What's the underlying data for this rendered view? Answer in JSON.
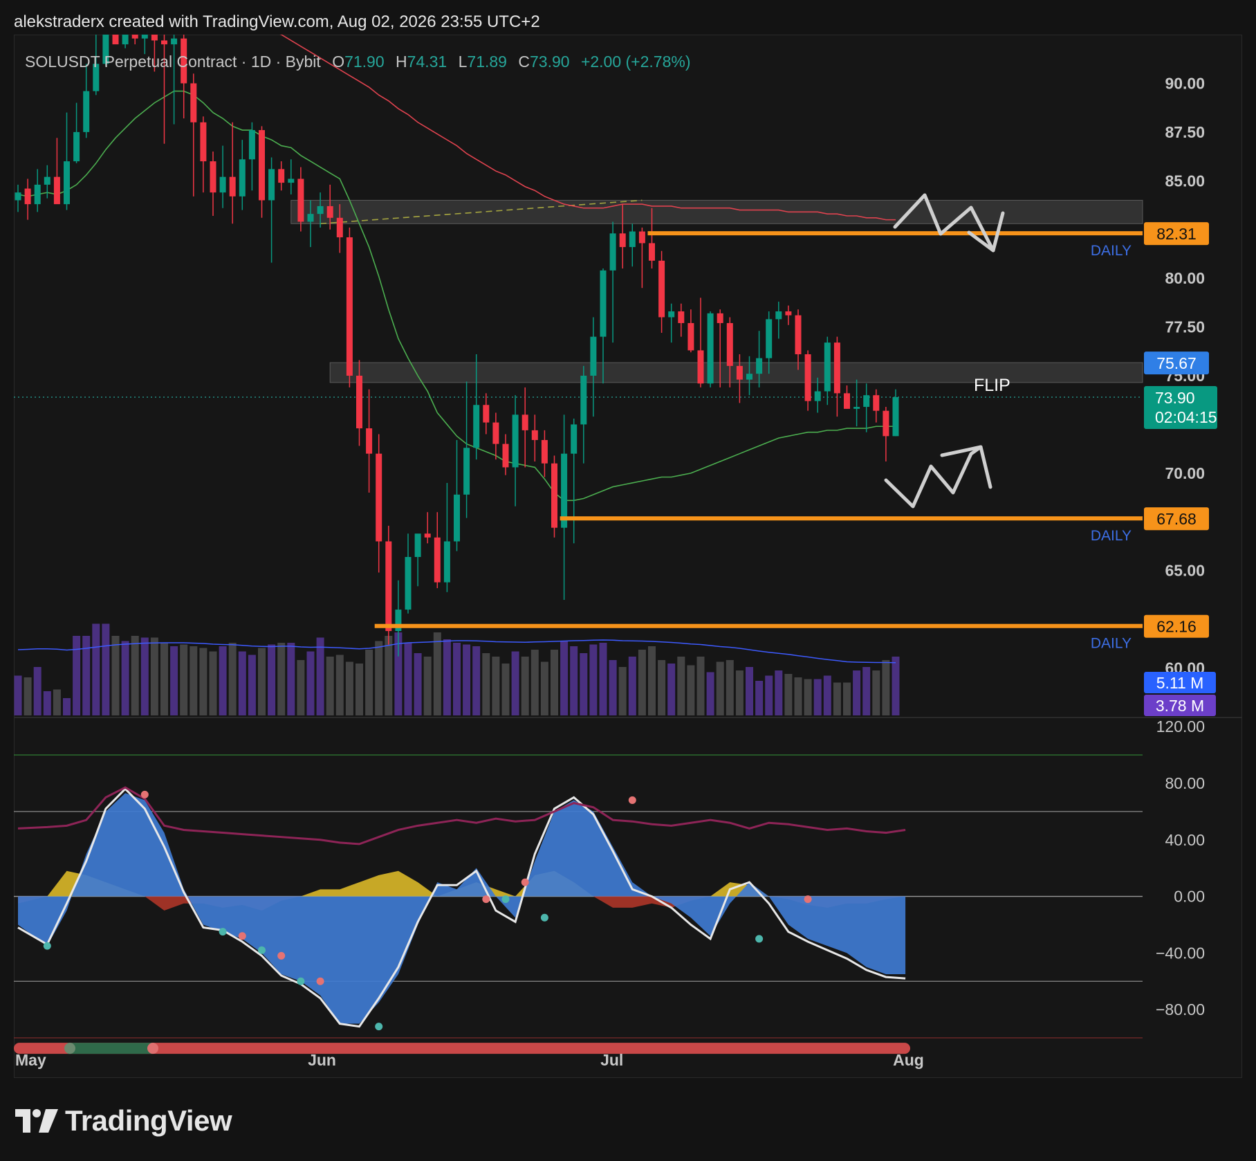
{
  "header": {
    "attribution": "alekstraderx created with TradingView.com, Aug 02, 2026 23:55 UTC+2"
  },
  "legend": {
    "title": "SOLUSDT Perpetual Contract · 1D · Bybit",
    "o_label": "O",
    "o": "71.90",
    "h_label": "H",
    "h": "74.31",
    "l_label": "L",
    "l": "71.89",
    "c_label": "C",
    "c": "73.90",
    "change": "+2.00 (+2.78%)"
  },
  "brand": {
    "name": "TradingView"
  },
  "colors": {
    "up": "#089981",
    "down": "#f23645",
    "level": "#f7931a",
    "ema_slow": "#e0434f",
    "ema_fast": "#4caf50",
    "volume_avg": "#3d5afe",
    "wave": "#3f7bd1",
    "money_flow": "#e6c229"
  },
  "chart_data": [
    {
      "type": "candlestick",
      "price_axis": {
        "ylim": [
          57.5,
          92.5
        ],
        "tick_values": [
          60,
          65,
          70,
          75,
          77.5,
          80,
          85,
          87.5,
          90
        ],
        "tick_labels": [
          "60.00",
          "65.00",
          "70.00",
          "75.00",
          "77.50",
          "80.00",
          "85.00",
          "87.50",
          "90.00"
        ]
      },
      "time_axis": {
        "labels": [
          "May",
          "Jun",
          "Jul",
          "Aug"
        ],
        "label_index": [
          1,
          31,
          61,
          91
        ]
      },
      "price_open": [
        84.0,
        84.6,
        83.8,
        84.8,
        85.2,
        83.8,
        86.0,
        87.5,
        89.6,
        91.0,
        93.0,
        92.0,
        92.5,
        92.3,
        92.5,
        92.2,
        92.0,
        92.3,
        90.0,
        88.0,
        86.0,
        84.4,
        85.2,
        84.2,
        86.1,
        87.6,
        84.0,
        85.6,
        84.9,
        85.1,
        82.9,
        83.3,
        83.7,
        83.1,
        82.1,
        75.0,
        72.3,
        71.0,
        66.5,
        61.9,
        63.0,
        65.7,
        66.9,
        66.7,
        64.4,
        66.5,
        68.9,
        71.3,
        73.5,
        72.6,
        71.5,
        70.3,
        73.0,
        72.2,
        71.7,
        70.5,
        67.2,
        71.0,
        72.5,
        75.0,
        77.0,
        80.4,
        82.3,
        81.6,
        82.4,
        81.8,
        80.9,
        78.0,
        78.3,
        77.7,
        76.3,
        74.6,
        78.2,
        77.7,
        75.5,
        74.8,
        75.1,
        75.9,
        77.9,
        78.3,
        78.1,
        76.1,
        73.7,
        74.2,
        76.7,
        74.1,
        73.3,
        73.4,
        74.0,
        73.2,
        71.9
      ],
      "price_high": [
        84.8,
        85.1,
        85.6,
        85.8,
        87.2,
        88.5,
        89.0,
        91.0,
        93.0,
        94.2,
        94.3,
        94.5,
        94.7,
        94.8,
        94.0,
        93.0,
        92.6,
        92.8,
        90.5,
        88.3,
        86.5,
        86.8,
        88.0,
        87.1,
        88.0,
        87.8,
        86.2,
        86.0,
        86.1,
        85.7,
        84.0,
        84.4,
        84.8,
        83.8,
        82.6,
        75.8,
        74.3,
        72.0,
        67.3,
        64.5,
        66.9,
        66.8,
        68.0,
        68.0,
        69.5,
        71.7,
        74.7,
        76.1,
        74.1,
        73.1,
        72.0,
        74.0,
        74.4,
        73.0,
        72.2,
        70.9,
        73.0,
        72.8,
        75.5,
        78.0,
        80.5,
        82.9,
        83.8,
        82.8,
        82.6,
        83.6,
        81.4,
        78.7,
        78.7,
        78.4,
        79.0,
        78.3,
        78.4,
        78.0,
        76.1,
        76.0,
        77.3,
        78.3,
        78.8,
        78.6,
        78.4,
        76.3,
        74.9,
        77.0,
        77.0,
        74.5,
        74.8,
        74.6,
        74.3,
        73.4,
        74.3
      ],
      "price_low": [
        83.4,
        83.0,
        83.4,
        84.1,
        84.8,
        83.5,
        85.9,
        87.2,
        89.4,
        90.9,
        92.1,
        91.8,
        92.0,
        91.5,
        90.6,
        86.9,
        87.9,
        88.2,
        84.2,
        84.4,
        83.2,
        83.6,
        82.8,
        83.5,
        84.5,
        83.1,
        80.8,
        84.5,
        84.3,
        82.4,
        81.6,
        82.6,
        82.5,
        81.3,
        74.4,
        71.4,
        69.0,
        64.9,
        61.2,
        60.6,
        62.8,
        64.2,
        66.4,
        64.1,
        63.9,
        66.0,
        67.7,
        70.7,
        72.0,
        70.7,
        69.9,
        68.3,
        70.3,
        70.6,
        69.8,
        66.7,
        63.5,
        66.4,
        70.5,
        72.9,
        74.6,
        76.7,
        80.5,
        80.6,
        79.5,
        80.5,
        77.2,
        76.7,
        77.0,
        76.2,
        74.4,
        74.4,
        74.4,
        74.4,
        73.6,
        74.0,
        74.4,
        75.1,
        76.9,
        77.6,
        75.3,
        73.2,
        73.1,
        73.5,
        72.9,
        73.3,
        72.4,
        72.1,
        72.6,
        70.6,
        71.9
      ],
      "price_close": [
        84.4,
        83.8,
        84.8,
        85.2,
        83.8,
        86.0,
        87.5,
        89.6,
        91.0,
        93.0,
        92.0,
        92.5,
        92.3,
        92.5,
        92.2,
        92.0,
        92.3,
        90.0,
        88.0,
        86.0,
        84.4,
        85.2,
        84.2,
        86.1,
        87.6,
        84.0,
        85.6,
        84.9,
        85.1,
        82.9,
        83.3,
        83.7,
        83.1,
        82.1,
        75.0,
        72.3,
        71.0,
        66.5,
        61.9,
        63.0,
        65.7,
        66.9,
        66.7,
        64.4,
        66.5,
        68.9,
        71.3,
        73.5,
        72.6,
        71.5,
        70.3,
        73.0,
        72.2,
        71.7,
        70.5,
        67.2,
        71.0,
        72.5,
        75.0,
        77.0,
        80.4,
        82.3,
        81.6,
        82.4,
        81.8,
        80.9,
        78.0,
        78.3,
        77.7,
        76.3,
        74.6,
        78.2,
        77.7,
        75.5,
        74.8,
        75.1,
        75.9,
        77.9,
        78.3,
        78.1,
        76.1,
        73.7,
        74.2,
        76.7,
        74.1,
        73.3,
        73.4,
        74.0,
        73.2,
        71.9,
        73.9
      ],
      "ema_fast_values": [
        84.3,
        84.2,
        84.3,
        84.4,
        84.3,
        84.5,
        84.8,
        85.3,
        85.9,
        86.6,
        87.2,
        87.7,
        88.2,
        88.6,
        89.0,
        89.3,
        89.6,
        89.6,
        89.4,
        89.0,
        88.5,
        88.2,
        87.8,
        87.6,
        87.6,
        87.3,
        87.1,
        86.8,
        86.7,
        86.3,
        86.0,
        85.7,
        85.4,
        85.1,
        84.0,
        82.8,
        81.6,
        80.1,
        78.4,
        76.9,
        75.9,
        75.0,
        74.2,
        73.1,
        72.5,
        71.9,
        71.5,
        71.3,
        71.1,
        70.9,
        70.6,
        70.5,
        70.4,
        70.3,
        69.7,
        69.0,
        68.6,
        68.6,
        68.7,
        68.9,
        69.1,
        69.3,
        69.4,
        69.5,
        69.6,
        69.7,
        69.8,
        69.8,
        69.9,
        70.0,
        70.2,
        70.4,
        70.6,
        70.8,
        71.0,
        71.2,
        71.4,
        71.6,
        71.8,
        71.9,
        72.0,
        72.1,
        72.1,
        72.2,
        72.2,
        72.3,
        72.3,
        72.3,
        72.4,
        72.4,
        72.4
      ],
      "ema_slow_values": [
        null,
        null,
        null,
        null,
        null,
        null,
        null,
        null,
        null,
        null,
        null,
        null,
        null,
        null,
        94.7,
        94.6,
        94.5,
        94.4,
        94.2,
        94.1,
        94.0,
        93.8,
        93.6,
        93.4,
        93.2,
        93.0,
        92.7,
        92.5,
        92.2,
        91.9,
        91.6,
        91.3,
        91.0,
        90.7,
        90.4,
        90.1,
        89.8,
        89.4,
        89.1,
        88.7,
        88.4,
        88.0,
        87.7,
        87.4,
        87.1,
        86.8,
        86.4,
        86.1,
        85.8,
        85.5,
        85.3,
        85.0,
        84.7,
        84.5,
        84.2,
        84.0,
        83.8,
        83.7,
        83.6,
        83.6,
        83.6,
        83.7,
        83.8,
        83.8,
        83.8,
        83.7,
        83.7,
        83.7,
        83.6,
        83.6,
        83.6,
        83.6,
        83.6,
        83.6,
        83.5,
        83.5,
        83.5,
        83.5,
        83.5,
        83.4,
        83.4,
        83.4,
        83.4,
        83.3,
        83.3,
        83.2,
        83.2,
        83.1,
        83.1,
        83.0,
        83.0
      ],
      "volume_values": [
        2.3,
        2.2,
        2.8,
        1.4,
        1.5,
        1.0,
        4.6,
        4.6,
        5.3,
        5.3,
        4.6,
        4.3,
        4.6,
        4.5,
        4.5,
        4.2,
        4.0,
        4.1,
        4.0,
        3.9,
        3.7,
        4.0,
        4.2,
        3.7,
        3.5,
        3.9,
        4.1,
        4.2,
        4.2,
        3.2,
        3.7,
        4.5,
        3.4,
        3.5,
        3.1,
        3.0,
        3.8,
        4.3,
        4.6,
        4.8,
        4.2,
        3.6,
        3.4,
        4.8,
        4.4,
        4.2,
        4.1,
        4.0,
        3.6,
        3.4,
        3.0,
        3.7,
        3.4,
        3.8,
        3.1,
        3.8,
        4.3,
        4.0,
        3.6,
        4.1,
        4.2,
        3.2,
        2.8,
        3.4,
        3.8,
        4.0,
        3.2,
        3.0,
        3.4,
        2.9,
        3.4,
        2.5,
        3.1,
        3.2,
        2.6,
        2.8,
        2.0,
        2.3,
        2.6,
        2.4,
        2.2,
        2.1,
        2.1,
        2.3,
        1.9,
        1.9,
        2.6,
        2.8,
        2.6,
        3.2,
        3.4
      ],
      "volume_avg_values": [
        3.8,
        3.82,
        3.85,
        3.85,
        3.83,
        3.78,
        3.82,
        3.88,
        3.95,
        4.02,
        4.08,
        4.12,
        4.15,
        4.18,
        4.19,
        4.2,
        4.2,
        4.2,
        4.18,
        4.16,
        4.12,
        4.1,
        4.09,
        4.05,
        4.01,
        3.99,
        3.98,
        4.0,
        4.0,
        3.96,
        3.94,
        3.95,
        3.93,
        3.91,
        3.88,
        3.85,
        3.88,
        3.95,
        4.05,
        4.15,
        4.2,
        4.22,
        4.24,
        4.27,
        4.3,
        4.32,
        4.32,
        4.31,
        4.29,
        4.26,
        4.25,
        4.24,
        4.23,
        4.25,
        4.26,
        4.28,
        4.3,
        4.32,
        4.33,
        4.35,
        4.36,
        4.35,
        4.32,
        4.31,
        4.3,
        4.28,
        4.25,
        4.22,
        4.18,
        4.13,
        4.1,
        4.04,
        3.98,
        3.94,
        3.88,
        3.8,
        3.72,
        3.65,
        3.59,
        3.53,
        3.45,
        3.38,
        3.3,
        3.23,
        3.17,
        3.1,
        3.08,
        3.07,
        3.06,
        3.06,
        3.05
      ],
      "level_lines": [
        {
          "price": 82.31,
          "label": "82.31",
          "tag": "DAILY",
          "from_index": 65
        },
        {
          "price": 67.68,
          "label": "67.68",
          "tag": "DAILY",
          "from_index": 56
        },
        {
          "price": 62.16,
          "label": "62.16",
          "tag": "DAILY",
          "from_index": 37
        }
      ],
      "zones": [
        {
          "from_index": 28,
          "top": 84.0,
          "bottom": 82.8
        },
        {
          "from_index": 32,
          "top": 75.67,
          "bottom": 74.65,
          "label": "FLIP"
        }
      ],
      "trend_line": {
        "from_index": 31,
        "from_price": 82.8,
        "to_index": 64,
        "to_price": 84.0
      },
      "zone_price_label": "75.67",
      "last_price": {
        "value": 73.9,
        "label": "73.90",
        "countdown": "02:04:15"
      },
      "volume_labels": [
        "5.11 M",
        "3.78 M"
      ],
      "scenario_arrows": [
        "down",
        "up"
      ]
    },
    {
      "type": "oscillator",
      "ylim": [
        -100,
        125
      ],
      "tick_values": [
        120,
        80,
        40,
        0,
        -40,
        -80
      ],
      "tick_labels": [
        "120.00",
        "80.00",
        "40.00",
        "0.00",
        "−40.00",
        "−80.00"
      ],
      "levels": [
        100,
        60,
        0,
        -60,
        -100
      ],
      "wave_x": [
        0,
        3,
        5,
        7,
        9,
        11,
        13,
        15,
        17,
        19,
        21,
        23,
        25,
        27,
        29,
        31,
        33,
        35,
        37,
        39,
        41,
        43,
        45,
        47,
        49,
        51,
        53,
        55,
        57,
        59,
        61,
        63,
        65,
        67,
        69,
        71,
        73,
        75,
        77,
        79,
        81,
        83,
        85,
        87,
        89,
        91
      ],
      "wave_y": [
        -20,
        -35,
        -10,
        30,
        60,
        73,
        68,
        45,
        5,
        -20,
        -25,
        -30,
        -40,
        -55,
        -60,
        -70,
        -90,
        -90,
        -75,
        -55,
        -20,
        10,
        5,
        20,
        0,
        -15,
        25,
        60,
        68,
        60,
        35,
        10,
        0,
        -5,
        -15,
        -28,
        -5,
        10,
        0,
        -20,
        -30,
        -35,
        -40,
        -50,
        -55,
        -55
      ],
      "wave_signal": [
        -22,
        -34,
        -5,
        25,
        62,
        76,
        62,
        35,
        3,
        -22,
        -24,
        -32,
        -42,
        -56,
        -62,
        -72,
        -90,
        -92,
        -72,
        -50,
        -18,
        8,
        8,
        18,
        -10,
        -18,
        30,
        62,
        70,
        58,
        32,
        5,
        0,
        -8,
        -20,
        -30,
        5,
        10,
        -5,
        -25,
        -32,
        -38,
        -44,
        -52,
        -57,
        -58
      ],
      "money_flow": [
        -5,
        0,
        18,
        15,
        10,
        5,
        0,
        -10,
        -5,
        -5,
        -8,
        -6,
        -10,
        -3,
        0,
        5,
        5,
        10,
        15,
        18,
        10,
        0,
        5,
        10,
        5,
        0,
        15,
        18,
        10,
        0,
        -8,
        -8,
        -5,
        -8,
        -3,
        0,
        10,
        8,
        0,
        -2,
        -6,
        -8,
        -5,
        -5,
        -2,
        0
      ],
      "rsi_like": [
        48,
        49,
        50,
        54,
        70,
        77,
        69,
        50,
        47,
        46,
        45,
        44,
        43,
        42,
        41,
        40,
        38,
        37,
        42,
        47,
        50,
        52,
        54,
        52,
        55,
        53,
        54,
        60,
        66,
        63,
        54,
        53,
        51,
        50,
        52,
        54,
        52,
        48,
        52,
        51,
        49,
        47,
        48,
        46,
        45,
        47
      ]
    }
  ]
}
